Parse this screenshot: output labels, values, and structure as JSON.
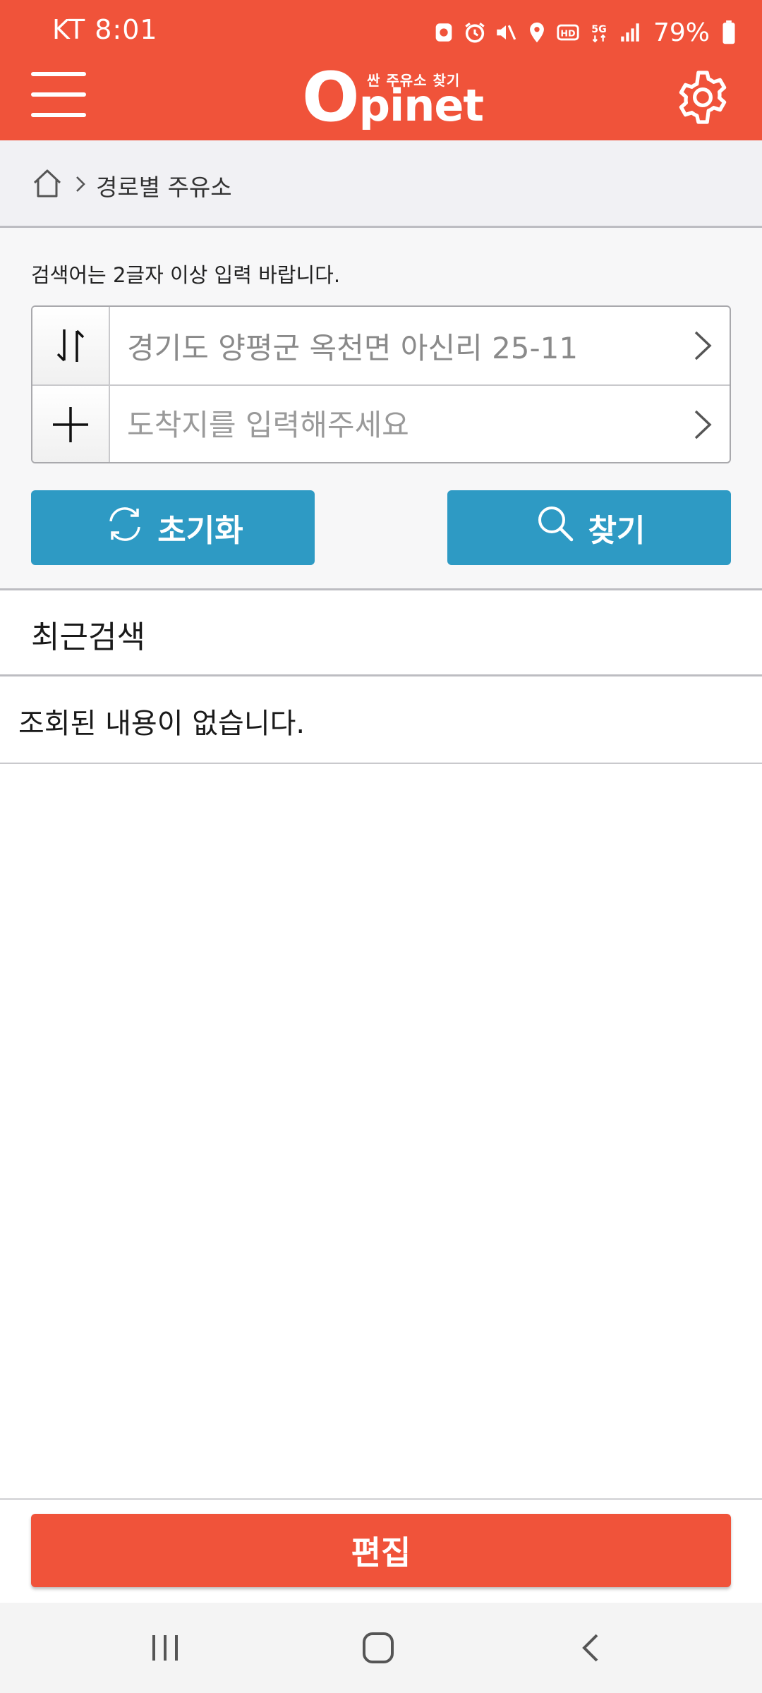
{
  "status": {
    "carrier_time": "KT 8:01",
    "battery_pct": "79%",
    "icons": [
      "app-icon",
      "alarm-icon",
      "mute-icon",
      "location-icon",
      "hd-icon",
      "5g-icon",
      "signal-icon",
      "battery-icon"
    ]
  },
  "header": {
    "logo_big": "O",
    "logo_rest": "pinet",
    "logo_tagline": "싼 주유소 찾기",
    "menu_icon": "hamburger-menu-icon",
    "settings_icon": "gear-icon",
    "color": "#f0533a"
  },
  "breadcrumb": {
    "home_icon": "home-icon",
    "current": "경로별 주유소"
  },
  "search": {
    "hint": "검색어는 2글자 이상 입력 바랍니다.",
    "origin_value": "경기도 양평군 옥천면 아신리 25-11",
    "destination_placeholder": "도착지를 입력해주세요",
    "reset_label": "초기화",
    "find_label": "찾기",
    "button_color": "#2e9ac4"
  },
  "recent": {
    "title": "최근검색",
    "empty_message": "조회된 내용이 없습니다."
  },
  "footer": {
    "edit_label": "편집"
  }
}
